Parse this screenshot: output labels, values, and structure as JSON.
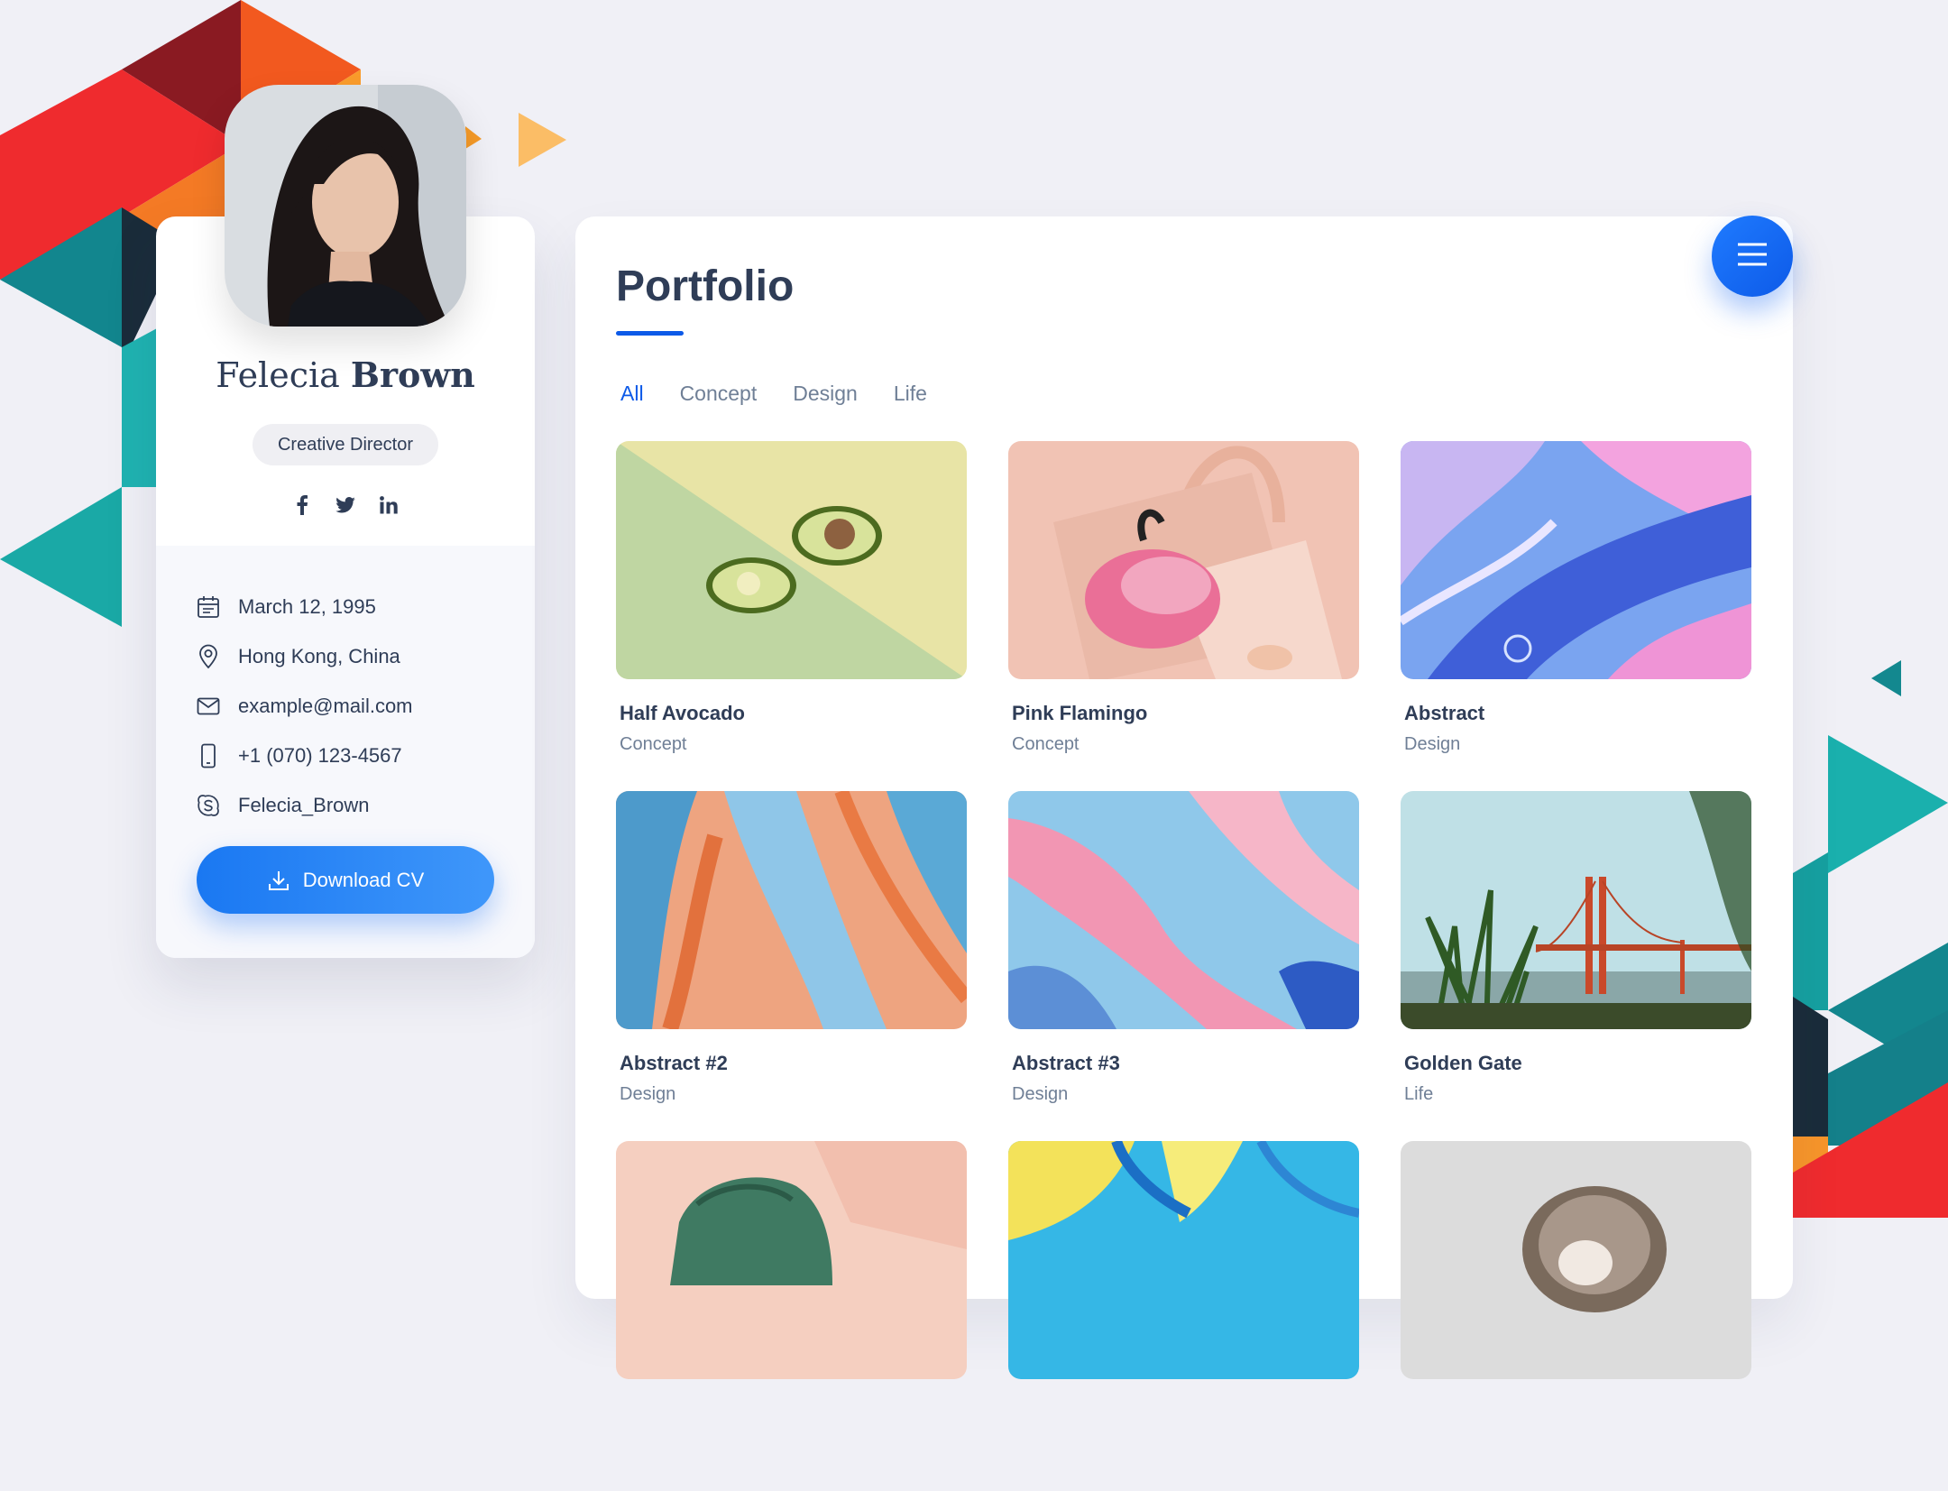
{
  "profile": {
    "first_name": "Felecia",
    "last_name": "Brown",
    "role": "Creative Director",
    "socials": [
      {
        "name": "facebook-icon",
        "glyph": "f"
      },
      {
        "name": "twitter-icon",
        "glyph": ""
      },
      {
        "name": "linkedin-icon",
        "glyph": "in"
      }
    ],
    "info": {
      "birthday": "March 12, 1995",
      "location": "Hong Kong, China",
      "email": "example@mail.com",
      "phone": "+1 (070) 123-4567",
      "skype": "Felecia_Brown"
    },
    "download_label": "Download CV"
  },
  "portfolio": {
    "title": "Portfolio",
    "filters": [
      "All",
      "Concept",
      "Design",
      "Life"
    ],
    "active_filter": "All",
    "items": [
      {
        "title": "Half Avocado",
        "category": "Concept"
      },
      {
        "title": "Pink Flamingo",
        "category": "Concept"
      },
      {
        "title": "Abstract",
        "category": "Design"
      },
      {
        "title": "Abstract #2",
        "category": "Design"
      },
      {
        "title": "Abstract #3",
        "category": "Design"
      },
      {
        "title": "Golden Gate",
        "category": "Life"
      },
      {
        "title": "",
        "category": ""
      },
      {
        "title": "",
        "category": ""
      },
      {
        "title": "",
        "category": ""
      }
    ]
  },
  "colors": {
    "accent": "#0d5ae8",
    "button": "#1a78f2",
    "text": "#2f3d57",
    "muted": "#6f7f96",
    "background": "#f0f0f6"
  }
}
